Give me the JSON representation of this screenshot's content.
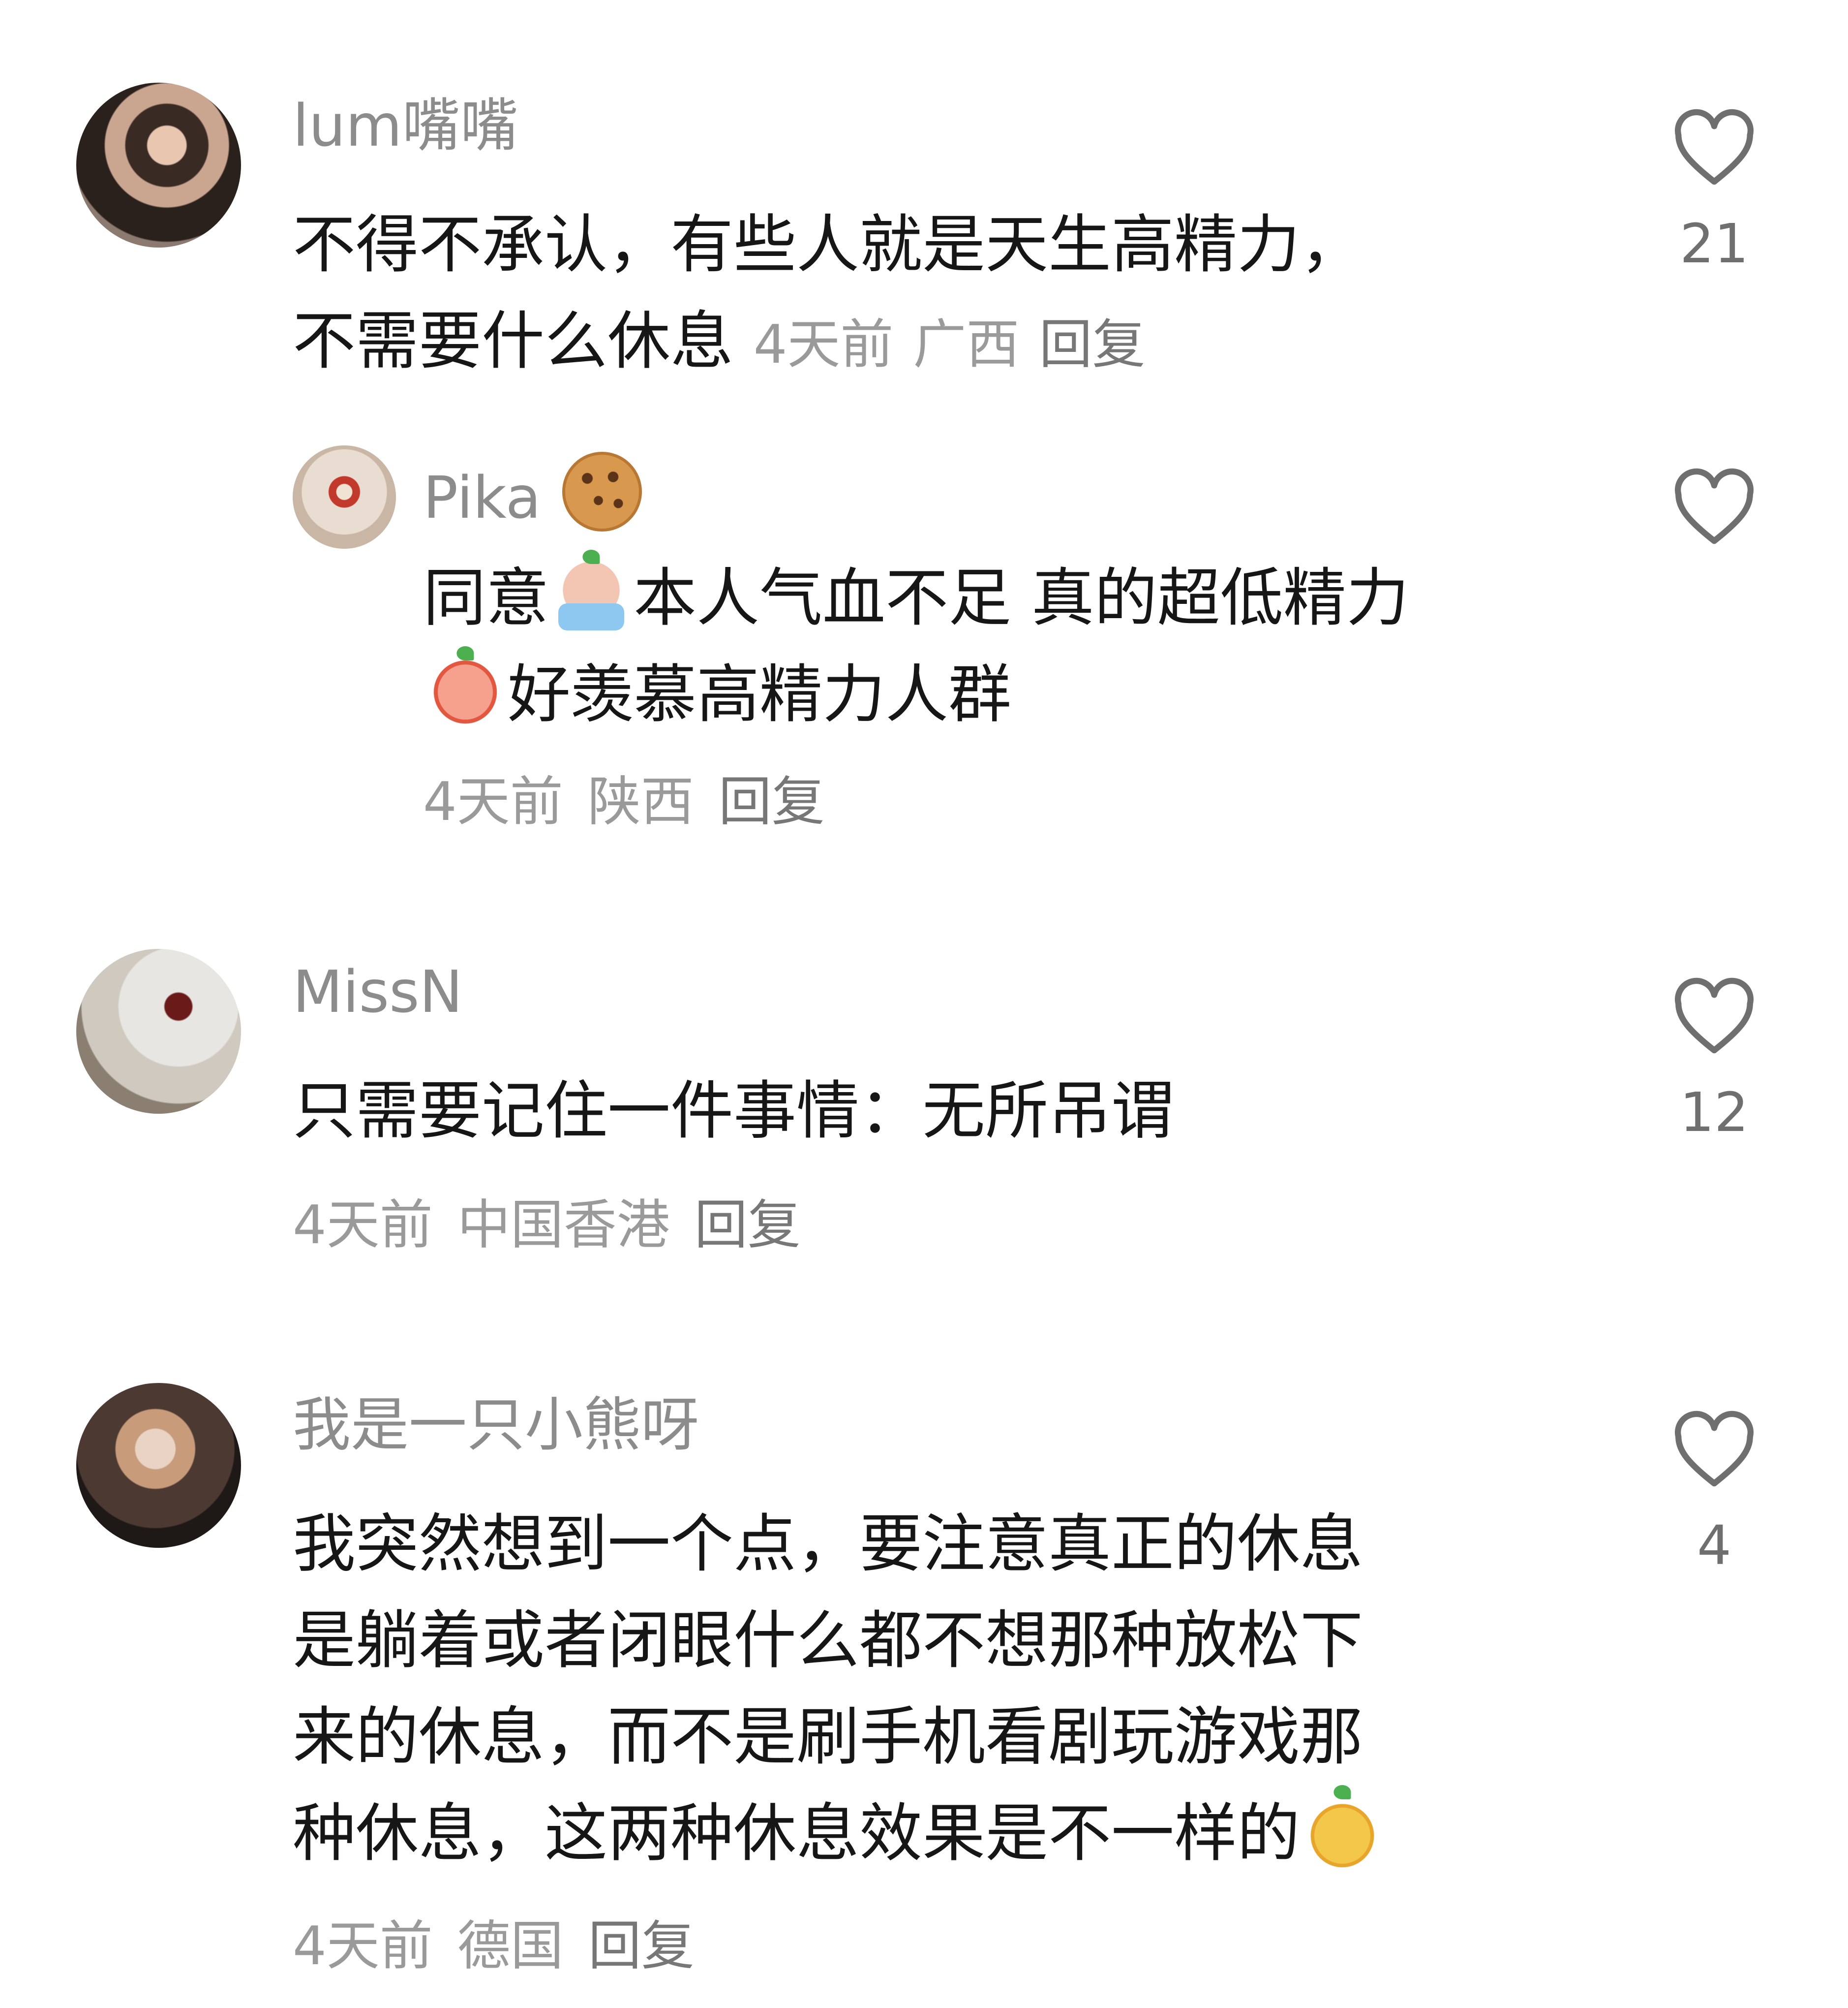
{
  "comments": [
    {
      "username": "lum嘴嘴",
      "text_lines": [
        "不得不承认，有些人就是天生高精力，",
        "不需要什么休息"
      ],
      "time": "4天前",
      "location": "广西",
      "reply_label": "回复",
      "likes": "21",
      "avatar_icon": "avatar-woman-icon",
      "replies": [
        {
          "username": "Pika",
          "username_emoji": "cookie-emoji-icon",
          "text_lines": [
            [
              "同意",
              "cry-emoji",
              "本人气血不足 真的超低精力"
            ],
            [
              "sob-emoji",
              "好羡慕高精力人群"
            ]
          ],
          "text_parts": {
            "line1_a": "同意",
            "line1_b": "本人气血不足 真的超低精力",
            "line2_b": "好羡慕高精力人群"
          },
          "time": "4天前",
          "location": "陕西",
          "reply_label": "回复",
          "likes": ""
        }
      ]
    },
    {
      "username": "MissN",
      "text_lines": [
        "只需要记住一件事情：无所吊谓"
      ],
      "time": "4天前",
      "location": "中国香港",
      "reply_label": "回复",
      "likes": "12"
    },
    {
      "username": "我是一只小熊呀",
      "text_lines": [
        "我突然想到一个点，要注意真正的休息",
        "是躺着或者闭眼什么都不想那种放松下",
        "来的休息，而不是刷手机看剧玩游戏那",
        "种休息，这两种休息效果是不一样的"
      ],
      "time": "4天前",
      "location": "德国",
      "reply_label": "回复",
      "likes": "4"
    }
  ],
  "colors": {
    "username": "#8c8c8c",
    "text": "#161616",
    "meta": "#9a9a9a",
    "like_icon": "#6f6f6f"
  }
}
